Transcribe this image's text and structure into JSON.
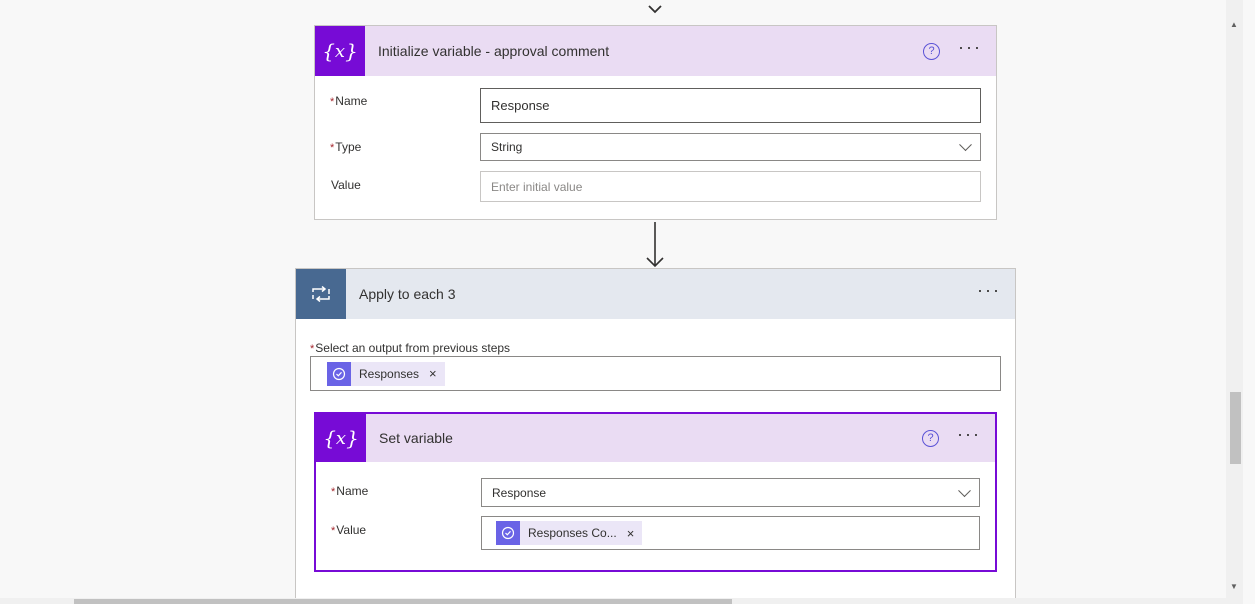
{
  "init_card": {
    "title": "Initialize variable - approval comment",
    "help": "?",
    "more": "···",
    "icon": "variable-icon",
    "fields": {
      "name_label": "Name",
      "name_value": "Response",
      "type_label": "Type",
      "type_value": "String",
      "value_label": "Value",
      "value_placeholder": "Enter initial value"
    }
  },
  "loop_card": {
    "title": "Apply to each 3",
    "more": "···",
    "icon": "loop-icon",
    "select_label": "Select an output from previous steps",
    "token_label": "Responses",
    "token_close": "×"
  },
  "set_card": {
    "title": "Set variable",
    "help": "?",
    "more": "···",
    "icon": "variable-icon",
    "fields": {
      "name_label": "Name",
      "name_value": "Response",
      "value_label": "Value",
      "token_label": "Responses Co...",
      "token_close": "×"
    }
  },
  "required_marker": "*",
  "colors": {
    "variable_accent": "#770bd6",
    "variable_header": "#eadcf3",
    "loop_accent": "#486991",
    "loop_header": "#e4e8ef",
    "token_bg": "#ebe6f7",
    "token_icon": "#6a63e6",
    "required": "#a4262c"
  }
}
